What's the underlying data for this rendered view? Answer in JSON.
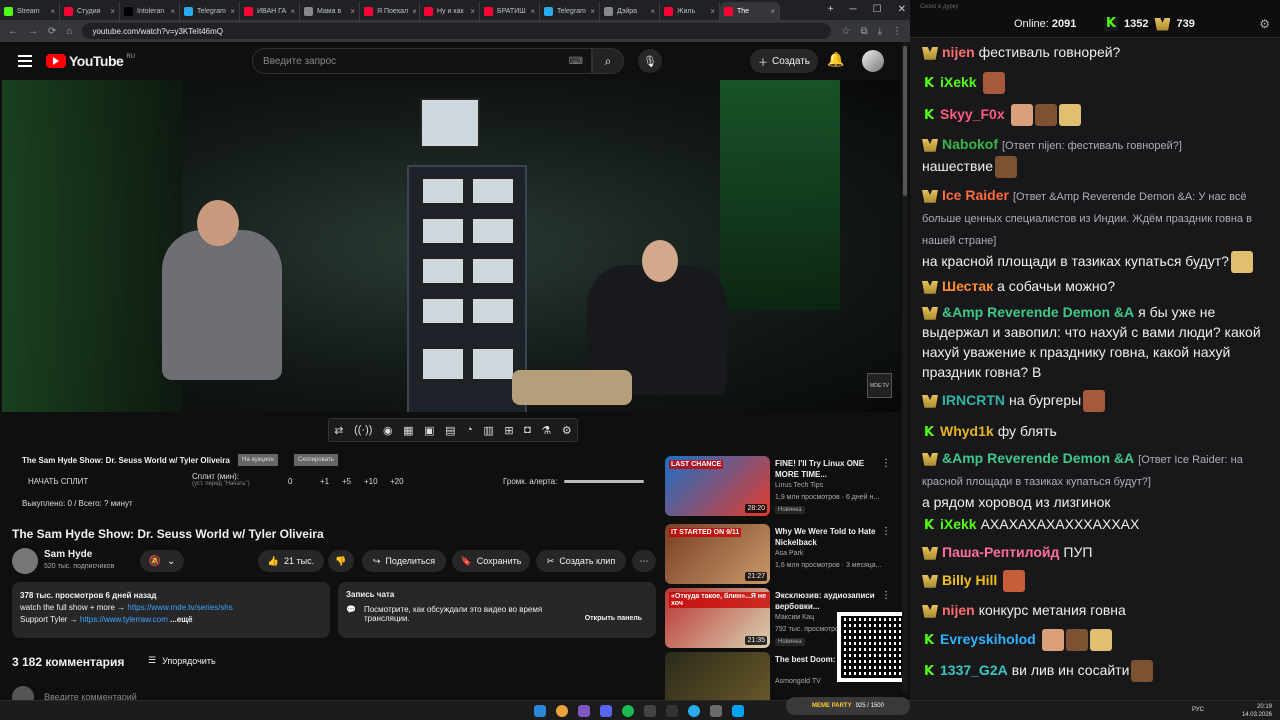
{
  "tabs": [
    {
      "label": "Stream",
      "color": "#53fc18",
      "icon": "kick-icon"
    },
    {
      "label": "Студия",
      "color": "#ff0033",
      "icon": "youtube-icon"
    },
    {
      "label": "Intoleran",
      "color": "#000000",
      "icon": "x-icon"
    },
    {
      "label": "Telegram",
      "color": "#2aabee",
      "icon": "telegram-icon"
    },
    {
      "label": "ИВАН ГА",
      "color": "#ff0033",
      "icon": "youtube-icon"
    },
    {
      "label": "Мама в",
      "color": "#888888",
      "icon": "globe-icon"
    },
    {
      "label": "Я Поехал",
      "color": "#ff0033",
      "icon": "youtube-icon"
    },
    {
      "label": "Ну и как",
      "color": "#ff0033",
      "icon": "youtube-icon"
    },
    {
      "label": "БРАТИШ",
      "color": "#ff0033",
      "icon": "youtube-icon"
    },
    {
      "label": "Telegram",
      "color": "#2aabee",
      "icon": "telegram-icon"
    },
    {
      "label": "Дэйра",
      "color": "#888888",
      "icon": "globe-icon"
    },
    {
      "label": "Жиль",
      "color": "#ff0033",
      "icon": "youtube-icon"
    },
    {
      "label": "The",
      "color": "#ff0033",
      "icon": "youtube-icon",
      "active": true
    }
  ],
  "url": "youtube.com/watch?v=y3KTeIt46mQ",
  "youtube": {
    "logo": "YouTube",
    "region": "RU",
    "search_placeholder": "Введите запрос",
    "create": "Создать"
  },
  "panel": {
    "title": "The Sam Hyde Show: Dr. Seuss World w/ Tyler Oliveira",
    "badge1": "На аукцион",
    "badge2": "Скопировать",
    "start_split": "НАЧАТЬ СПЛИТ",
    "split_label": "Сплит (мин):",
    "split_hint": "(уст. перед \"Начать\")",
    "split_val": "0",
    "btn1": "+1",
    "btn5": "+5",
    "btn10": "+10",
    "btn20": "+20",
    "volume_label": "Громк. алерта:",
    "progress": "Выкуплено: 0 / Всего: ? минут"
  },
  "video": {
    "title": "The Sam Hyde Show: Dr. Seuss World w/ Tyler Oliveira",
    "channel": "Sam Hyde",
    "subs": "520 тыс. подписчиков",
    "likes": "21 тыс.",
    "share": "Поделиться",
    "save": "Сохранить",
    "clip": "Создать клип",
    "stats": "378 тыс. просмотров  6 дней назад",
    "line1": "watch the full show + more → ",
    "link1": "https://www.mde.tv/series/shs",
    "line2": "Support Tyler → ",
    "link2": "https://www.tylerraw.com",
    "more": "...ещё",
    "chatrec_title": "Запись чата",
    "chatrec_text": "Посмотрите, как обсуждали это видео во время трансляции.",
    "chatrec_btn": "Открыть панель",
    "comments": "3 182 комментария",
    "sort": "Упорядочить",
    "add_comment": "Введите комментарий",
    "watermark": "MDE.TV"
  },
  "recs": [
    {
      "title": "FINE! I'll Try Linux ONE MORE TIME...",
      "channel": "Linus Tech Tips",
      "meta": "1,9 млн просмотров · 6 дней н...",
      "badge": "Новинка",
      "dur": "28:20",
      "thumb": "LAST CHANCE",
      "c1": "#1c6fc8",
      "c2": "#e23b2b"
    },
    {
      "title": "Why We Were Told to Hate Nickelback",
      "channel": "Asa Park",
      "meta": "1,6 млн просмотров · 3 месяца...",
      "badge": "",
      "dur": "21:27",
      "thumb": "IT STARTED ON 9/11",
      "c1": "#7a3e25",
      "c2": "#c89a6a"
    },
    {
      "title": "Эксклюзив: аудиозаписи вербовки...",
      "channel": "Максим Кац",
      "meta": "792 тыс. просмотров",
      "badge": "Новинка",
      "dur": "21:35",
      "thumb": "«Откуда такое, блин»...Я не хоч",
      "c1": "#b33",
      "c2": "#d9d2b0"
    },
    {
      "title": "The best Doom: Ages review",
      "channel": "Asmongold TV",
      "meta": "",
      "badge": "",
      "dur": "",
      "thumb": "",
      "c1": "#2a2a1a",
      "c2": "#6c5a2a"
    }
  ],
  "chat": {
    "small": "Скоко в дурку",
    "online_label": "Online:",
    "online": "2091",
    "kick_count": "1352",
    "badge_count": "739",
    "messages": [
      {
        "user": "nijen",
        "color": "#ff6e6e",
        "text": "фестиваль говнорей?",
        "reply": "",
        "badge": "gold"
      },
      {
        "user": "iXekk",
        "color": "#53fc18",
        "text": "",
        "reply": "",
        "badge": "kick"
      },
      {
        "user": "Skyy_F0x",
        "color": "#ff5b7f",
        "text": "",
        "reply": "",
        "badge": "kick"
      },
      {
        "user": "Nabokof",
        "color": "#3ab54a",
        "text": "нашествие",
        "reply": "[Ответ nijen: фестиваль говнорей?]",
        "badge": "gold"
      },
      {
        "user": "Ice Raider",
        "color": "#ff6b3d",
        "text": "на красной площади в тазиках купаться будут?",
        "reply": "[Ответ &Amp Reverende Demon &A: У нас всё больше ценных специалистов из Индии. Ждём праздник говна в нашей стране]",
        "badge": "gold"
      },
      {
        "user": "Шестак",
        "color": "#ff8c2e",
        "text": "а собачьи можно?",
        "reply": "",
        "badge": "gold"
      },
      {
        "user": "&Amp Reverende Demon &A",
        "color": "#3ec98a",
        "text": "я бы уже не выдержал и завопил: что нахуй с вами люди? какой нахуй уважение к празднику говна, какой нахуй праздник говна? В",
        "reply": "",
        "badge": "gold"
      },
      {
        "user": "IRNCRTN",
        "color": "#2fb3a5",
        "text": "на бургеры",
        "reply": "",
        "badge": "gold"
      },
      {
        "user": "Whyd1k",
        "color": "#e6b422",
        "text": "фу блять",
        "reply": "",
        "badge": "kick"
      },
      {
        "user": "&Amp Reverende Demon &A",
        "color": "#3ec98a",
        "text": "а рядом хоровод из лизгинок",
        "reply": "[Ответ Ice Raider: на красной площади в тазиках купаться будут?]",
        "badge": "gold"
      },
      {
        "user": "iXekk",
        "color": "#53fc18",
        "text": "АХАХАХАХАХХХАХХАХ",
        "reply": "",
        "badge": "kick"
      },
      {
        "user": "Паша-Рептилойд",
        "color": "#ff6e9e",
        "text": "ПУП",
        "reply": "",
        "badge": "gold"
      },
      {
        "user": "Billy Hill",
        "color": "#f0c020",
        "text": "",
        "reply": "",
        "badge": "gold"
      },
      {
        "user": "nijen",
        "color": "#ff6e6e",
        "text": "конкурс метания говна",
        "reply": "",
        "badge": "gold"
      },
      {
        "user": "Evreyskiholod",
        "color": "#2db4ff",
        "text": "",
        "reply": "",
        "badge": "kick"
      },
      {
        "user": "1337_G2A",
        "color": "#3ac7c0",
        "text": "ви лив ин сосайти",
        "reply": "",
        "badge": "kick"
      }
    ]
  },
  "taskbar": {
    "lang": "РУС",
    "time": "20:19",
    "date": "14.03.2026",
    "meme_label": "MEME PARTY",
    "meme_count": "925 / 1500"
  }
}
